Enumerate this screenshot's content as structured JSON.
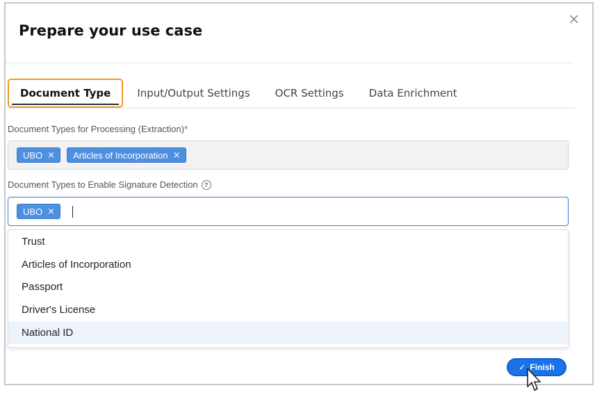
{
  "dialog": {
    "title": "Prepare your use case",
    "close_glyph": "×"
  },
  "tabs": [
    {
      "label": "Document Type",
      "active": true
    },
    {
      "label": "Input/Output Settings",
      "active": false
    },
    {
      "label": "OCR Settings",
      "active": false
    },
    {
      "label": "Data Enrichment",
      "active": false
    }
  ],
  "extraction": {
    "label": "Document Types for Processing (Extraction)",
    "required_mark": "*",
    "tags": [
      {
        "label": "UBO",
        "remove": "×"
      },
      {
        "label": "Articles of Incorporation",
        "remove": "×"
      }
    ]
  },
  "signature": {
    "label": "Document Types to Enable Signature Detection",
    "help_glyph": "?",
    "tags": [
      {
        "label": "UBO",
        "remove": "×"
      }
    ],
    "input_value": ""
  },
  "dropdown": {
    "options": [
      "Trust",
      "Articles of Incorporation",
      "Passport",
      "Driver's License",
      "National ID"
    ],
    "highlighted_index": 4
  },
  "footer": {
    "finish_label": "Finish",
    "check_glyph": "✓"
  },
  "colors": {
    "accent": "#1a73e8",
    "tag": "#4d8fe0",
    "active_tab_outline": "#f09a22",
    "required": "#d9432f"
  }
}
